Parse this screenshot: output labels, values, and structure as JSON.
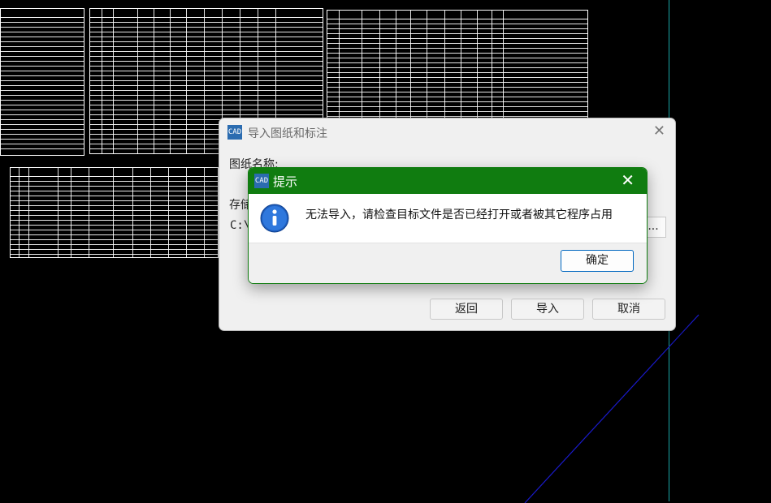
{
  "import_dialog": {
    "title": "导入图纸和标注",
    "drawing_name_label": "图纸名称:",
    "storage_label": "存储",
    "path_value": "C:\\",
    "browse_label": "...",
    "buttons": {
      "back": "返回",
      "import": "导入",
      "cancel": "取消"
    },
    "close_glyph": "✕"
  },
  "alert": {
    "title": "提示",
    "message": "无法导入，请检查目标文件是否已经打开或者被其它程序占用",
    "ok_label": "确定",
    "close_glyph": "✕",
    "icon": "info-icon",
    "title_bar_color": "#107c10"
  },
  "app_icon_text": "CAD"
}
